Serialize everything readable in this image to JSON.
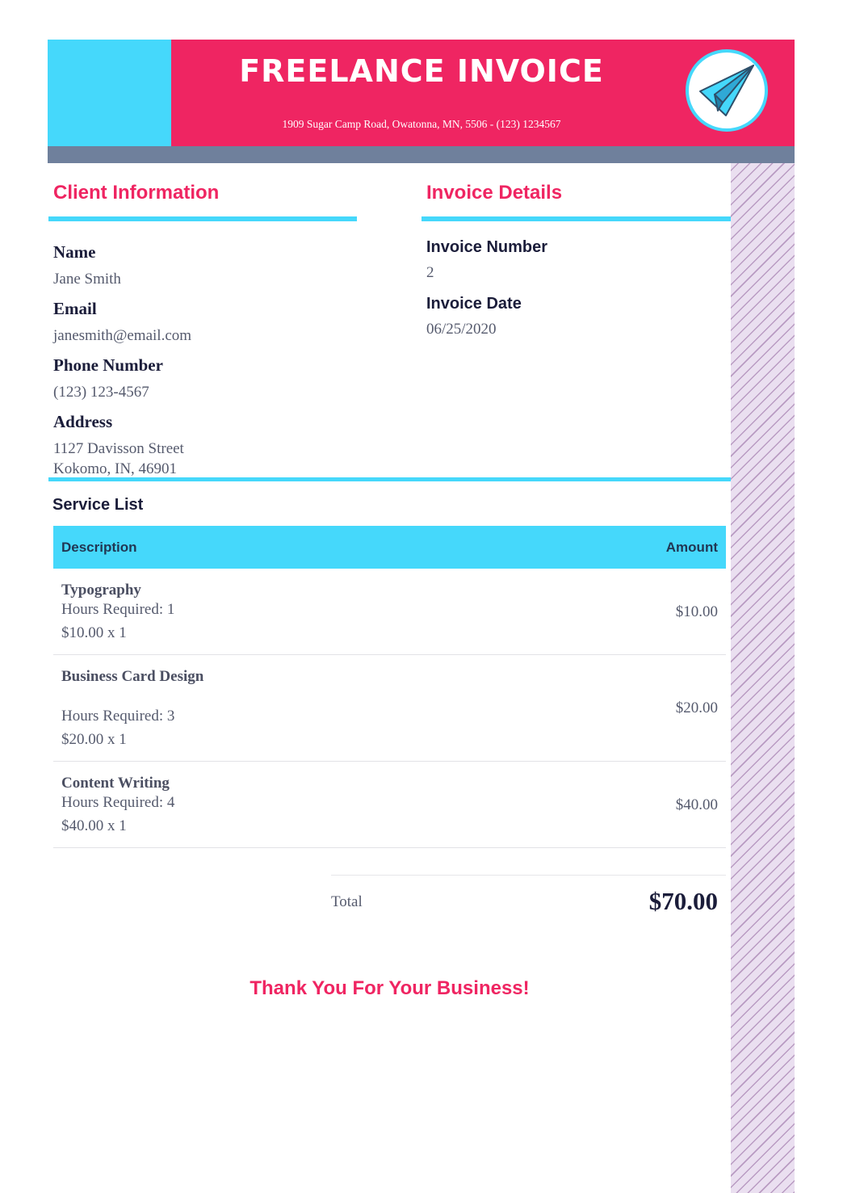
{
  "header": {
    "title": "FREELANCE INVOICE",
    "address_line": "1909 Sugar Camp Road, Owatonna, MN, 5506 - (123) 1234567",
    "logo_icon": "paper-plane-icon"
  },
  "client": {
    "section_title": "Client Information",
    "name_label": "Name",
    "name": "Jane Smith",
    "email_label": "Email",
    "email": "janesmith@email.com",
    "phone_label": "Phone Number",
    "phone": "(123) 123-4567",
    "address_label": "Address",
    "address_line1": "1127 Davisson Street",
    "address_line2": "Kokomo, IN, 46901"
  },
  "invoice": {
    "section_title": "Invoice Details",
    "number_label": "Invoice Number",
    "number": "2",
    "date_label": "Invoice Date",
    "date": "06/25/2020"
  },
  "services": {
    "title": "Service List",
    "col_description": "Description",
    "col_amount": "Amount",
    "items": [
      {
        "name": "Typography",
        "hours": "Hours Required: 1",
        "rate": "$10.00 x 1",
        "amount": "$10.00"
      },
      {
        "name": "Business Card Design",
        "hours": "Hours Required: 3",
        "rate": "$20.00 x 1",
        "amount": "$20.00"
      },
      {
        "name": "Content Writing",
        "hours": "Hours Required: 4",
        "rate": "$40.00 x 1",
        "amount": "$40.00"
      }
    ]
  },
  "totals": {
    "label": "Total",
    "value": "$70.00"
  },
  "footer": {
    "thanks": "Thank You For Your Business!"
  },
  "colors": {
    "accent_pink": "#ef2562",
    "accent_blue": "#45d8fb",
    "bar_gray": "#6f809c"
  }
}
